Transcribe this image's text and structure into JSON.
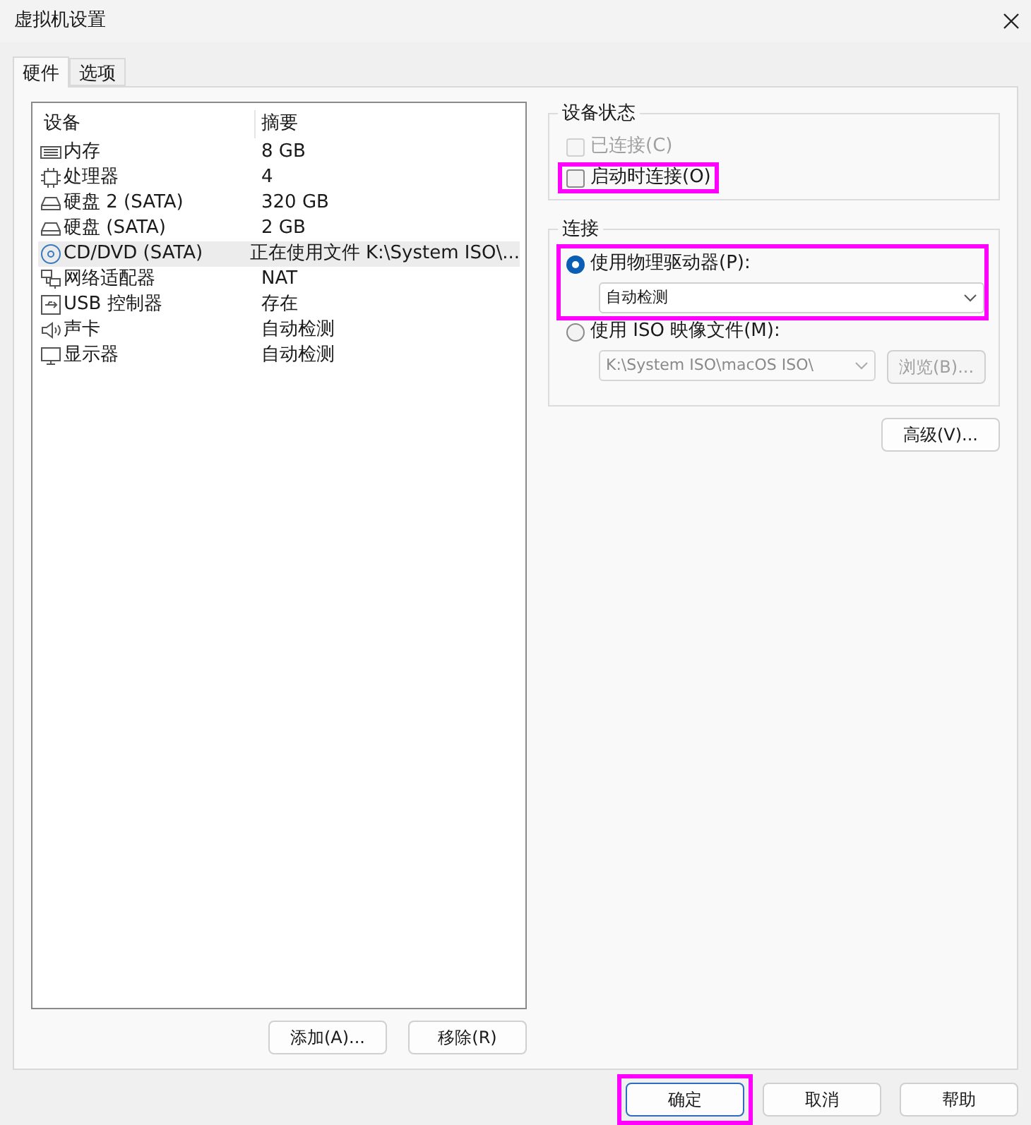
{
  "window": {
    "title": "虚拟机设置"
  },
  "tabs": [
    {
      "label": "硬件",
      "selected": true
    },
    {
      "label": "选项",
      "selected": false
    }
  ],
  "devices": {
    "columns": [
      "设备",
      "摘要"
    ],
    "rows": [
      {
        "kind": "memory",
        "name": "内存",
        "summary": "8 GB",
        "selected": false
      },
      {
        "kind": "cpu",
        "name": "处理器",
        "summary": "4",
        "selected": false
      },
      {
        "kind": "disk",
        "name": "硬盘 2 (SATA)",
        "summary": "320 GB",
        "selected": false
      },
      {
        "kind": "disk",
        "name": "硬盘 (SATA)",
        "summary": "2 GB",
        "selected": false
      },
      {
        "kind": "cdrom",
        "name": "CD/DVD (SATA)",
        "summary": "正在使用文件 K:\\System ISO\\...",
        "selected": true
      },
      {
        "kind": "network",
        "name": "网络适配器",
        "summary": "NAT",
        "selected": false
      },
      {
        "kind": "usb",
        "name": "USB 控制器",
        "summary": "存在",
        "selected": false
      },
      {
        "kind": "sound",
        "name": "声卡",
        "summary": "自动检测",
        "selected": false
      },
      {
        "kind": "display",
        "name": "显示器",
        "summary": "自动检测",
        "selected": false
      }
    ]
  },
  "device_status": {
    "title": "设备状态",
    "checkboxes": [
      {
        "label": "已连接(C)",
        "checked": false,
        "disabled": true,
        "highlighted": false
      },
      {
        "label": "启动时连接(O)",
        "checked": false,
        "disabled": false,
        "highlighted": true
      }
    ]
  },
  "connection": {
    "title": "连接",
    "options": [
      {
        "label": "使用物理驱动器(P):",
        "selected": true,
        "highlighted": true,
        "dropdown": {
          "value": "自动检测",
          "disabled": false
        }
      },
      {
        "label": "使用 ISO 映像文件(M):",
        "selected": false,
        "highlighted": false,
        "dropdown": {
          "value": "K:\\System ISO\\macOS ISO\\",
          "disabled": true
        },
        "browse_button": {
          "label": "浏览(B)...",
          "disabled": true
        }
      }
    ]
  },
  "advanced_button": "高级(V)...",
  "list_buttons": [
    "添加(A)...",
    "移除(R)"
  ],
  "dialog_buttons": [
    {
      "label": "确定",
      "default": true,
      "highlighted": true
    },
    {
      "label": "取消",
      "default": false,
      "highlighted": false
    },
    {
      "label": "帮助",
      "default": false,
      "highlighted": false
    }
  ]
}
